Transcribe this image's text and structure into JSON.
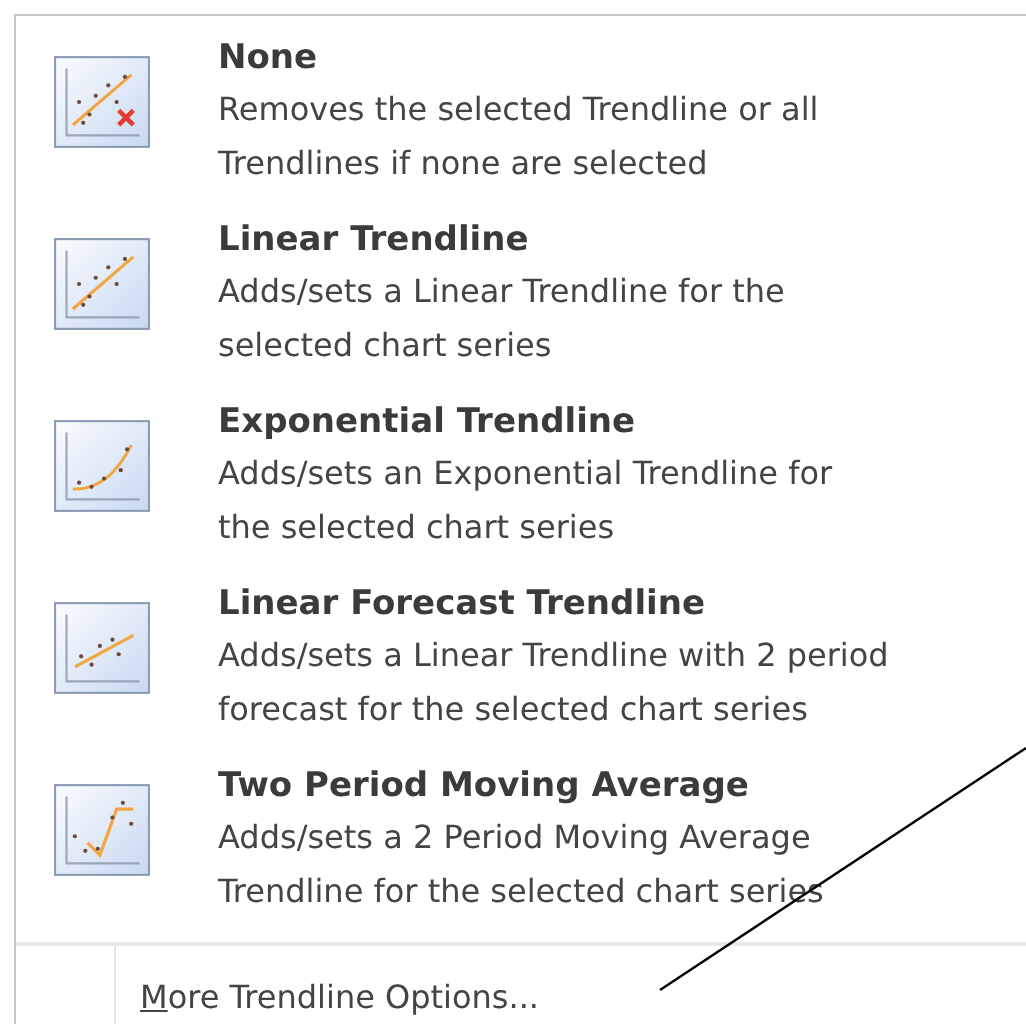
{
  "menu_items": [
    {
      "kind": "none",
      "title": "None",
      "description_lines": [
        "Removes the selected Trendline or all",
        "Trendlines if none are selected"
      ]
    },
    {
      "kind": "linear",
      "title": "Linear Trendline",
      "description_lines": [
        "Adds/sets a Linear Trendline for the",
        "selected chart series"
      ]
    },
    {
      "kind": "exponential",
      "title": "Exponential Trendline",
      "description_lines": [
        "Adds/sets an Exponential Trendline for",
        "the selected chart series"
      ]
    },
    {
      "kind": "forecast",
      "title": "Linear Forecast Trendline",
      "description_lines": [
        "Adds/sets a Linear Trendline with 2 period",
        "forecast for the selected chart series"
      ]
    },
    {
      "kind": "moving_average",
      "title": "Two Period Moving Average",
      "description_lines": [
        "Adds/sets a 2 Period Moving Average",
        "Trendline for the selected chart series"
      ]
    }
  ],
  "footer": {
    "access_key": "M",
    "label_rest": "ore Trendline Options..."
  }
}
